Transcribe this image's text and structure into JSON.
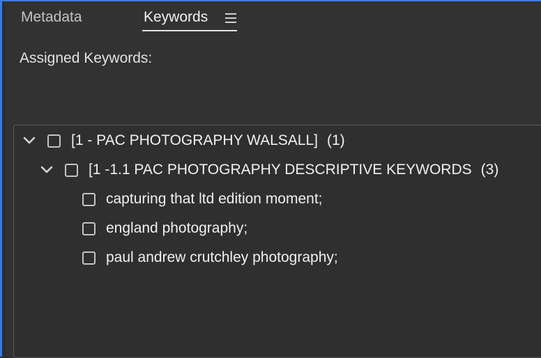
{
  "tabs": {
    "metadata_label": "Metadata",
    "keywords_label": "Keywords"
  },
  "menu_icon": "hamburger-menu-icon",
  "assigned_keywords_label": "Assigned Keywords:",
  "tree": {
    "group": {
      "label": "[1 - PAC PHOTOGRAPHY WALSALL]",
      "count": "(1)",
      "expanded": true,
      "checked": false
    },
    "subgroup": {
      "label": "[1 -1.1 PAC PHOTOGRAPHY DESCRIPTIVE KEYWORDS",
      "count": "(3)",
      "expanded": true,
      "checked": false
    },
    "keywords": [
      {
        "label": "capturing that ltd edition moment;",
        "checked": false
      },
      {
        "label": "england photography;",
        "checked": false
      },
      {
        "label": "paul andrew crutchley photography;",
        "checked": false
      }
    ]
  },
  "colors": {
    "panel_bg": "#323232",
    "accent_blue": "#3d7bd5",
    "text": "#f0f0f0"
  }
}
